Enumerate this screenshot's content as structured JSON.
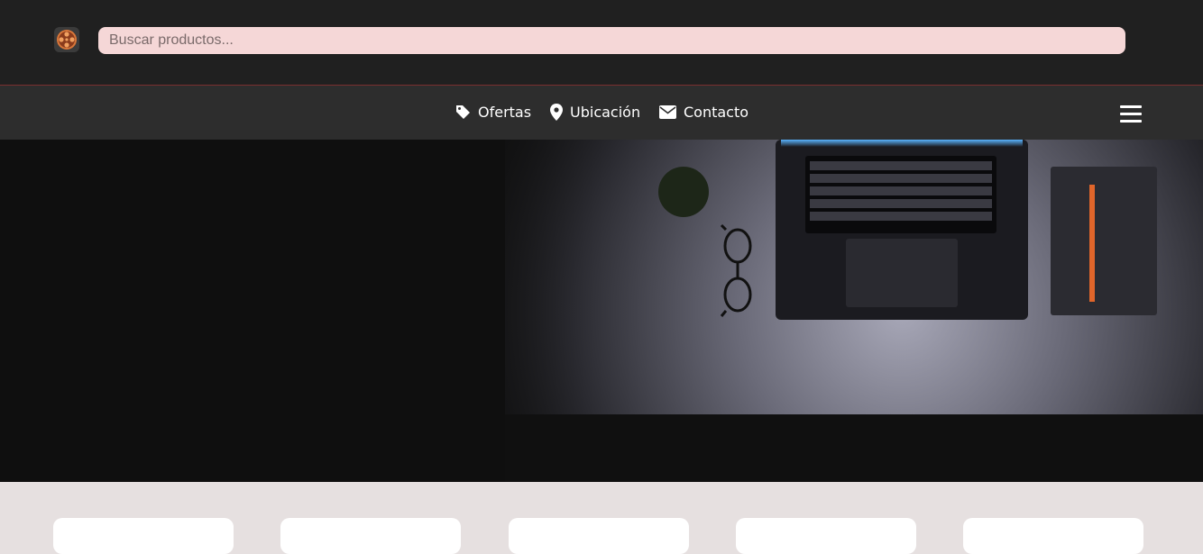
{
  "header": {
    "logo_icon": "film-reel-logo-icon",
    "search": {
      "placeholder": "Buscar productos...",
      "value": ""
    }
  },
  "nav": {
    "items": [
      {
        "label": "Ofertas",
        "icon": "tag-icon"
      },
      {
        "label": "Ubicación",
        "icon": "map-pin-icon"
      },
      {
        "label": "Contacto",
        "icon": "envelope-icon"
      }
    ],
    "menu_icon": "hamburger-menu-icon"
  },
  "hero": {
    "image": "laptop-on-desk-photo"
  },
  "colors": {
    "topbar": "#202020",
    "navbar": "#2d2d2d",
    "search_bg": "#f5d7d7",
    "page_bg": "#e6e0e0",
    "divider": "#7a2f2f"
  }
}
